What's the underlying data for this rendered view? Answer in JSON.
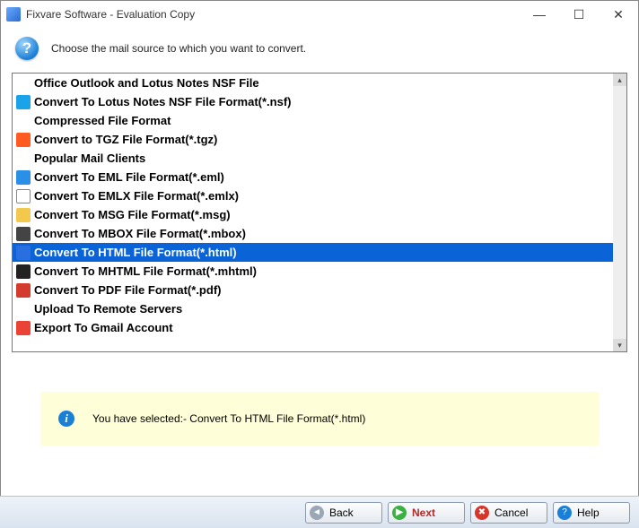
{
  "window": {
    "title": "Fixvare Software - Evaluation Copy",
    "instruction": "Choose the mail source to which you want to convert."
  },
  "list": [
    {
      "type": "header",
      "label": "Office Outlook and Lotus Notes NSF File"
    },
    {
      "type": "item",
      "icon": "nsf",
      "iconColor": "#1aa3e8",
      "label": "Convert To Lotus Notes NSF File Format(*.nsf)"
    },
    {
      "type": "header",
      "label": "Compressed File Format"
    },
    {
      "type": "item",
      "icon": "tgz",
      "iconColor": "#ff5a1f",
      "label": "Convert to TGZ File Format(*.tgz)"
    },
    {
      "type": "header",
      "label": "Popular Mail Clients"
    },
    {
      "type": "item",
      "icon": "eml",
      "iconColor": "#2a8fe6",
      "label": "Convert To EML File Format(*.eml)"
    },
    {
      "type": "item",
      "icon": "emlx",
      "iconColor": "#ffffff",
      "label": "Convert To EMLX File Format(*.emlx)"
    },
    {
      "type": "item",
      "icon": "msg",
      "iconColor": "#f2c94c",
      "label": "Convert To MSG File Format(*.msg)"
    },
    {
      "type": "item",
      "icon": "mbox",
      "iconColor": "#444444",
      "label": "Convert To MBOX File Format(*.mbox)"
    },
    {
      "type": "item",
      "icon": "html",
      "iconColor": "#2a6fe0",
      "label": "Convert To HTML File Format(*.html)",
      "selected": true
    },
    {
      "type": "item",
      "icon": "mhtml",
      "iconColor": "#222222",
      "label": "Convert To MHTML File Format(*.mhtml)"
    },
    {
      "type": "item",
      "icon": "pdf",
      "iconColor": "#d23b2e",
      "label": "Convert To PDF File Format(*.pdf)"
    },
    {
      "type": "header",
      "label": "Upload To Remote Servers"
    },
    {
      "type": "item",
      "icon": "gmail",
      "iconColor": "#ea4335",
      "label": "Export To Gmail Account"
    }
  ],
  "info": {
    "text": "You have selected:- Convert To HTML File Format(*.html)"
  },
  "buttons": {
    "back": "Back",
    "next": "Next",
    "cancel": "Cancel",
    "help": "Help"
  }
}
